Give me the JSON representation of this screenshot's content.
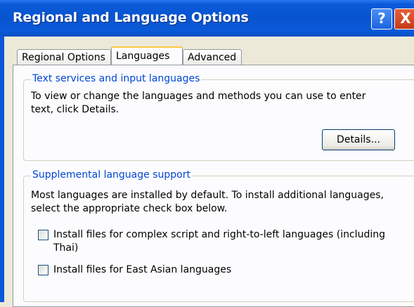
{
  "window": {
    "title": "Regional and Language Options",
    "help_button": "?",
    "close_button": "X"
  },
  "tabs": [
    {
      "label": "Regional Options",
      "selected": false
    },
    {
      "label": "Languages",
      "selected": true
    },
    {
      "label": "Advanced",
      "selected": false
    }
  ],
  "text_services": {
    "title": "Text services and input languages",
    "description": "To view or change the languages and methods you can use to enter text, click Details.",
    "details_button": "Details..."
  },
  "supplemental": {
    "title": "Supplemental language support",
    "description": "Most languages are installed by default. To install additional languages, select the appropriate check box below.",
    "checkboxes": [
      {
        "label": "Install files for complex script and right-to-left languages (including Thai)",
        "checked": false
      },
      {
        "label": "Install files for East Asian languages",
        "checked": false
      }
    ]
  },
  "colors": {
    "titlebar": "#0854d0",
    "group_title": "#0046d5",
    "dialog_bg": "#ece9d8",
    "close_button": "#c63a17"
  }
}
